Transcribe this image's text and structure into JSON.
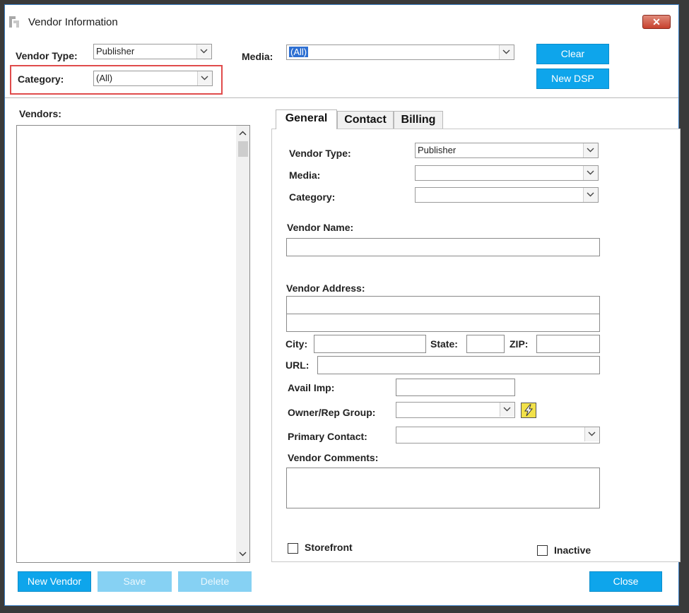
{
  "window": {
    "title": "Vendor Information",
    "close_glyph": "✕"
  },
  "filters": {
    "vendor_type_label": "Vendor Type:",
    "vendor_type_value": "Publisher",
    "category_label": "Category:",
    "category_value": "(All)",
    "media_label": "Media:",
    "media_value": "(All)"
  },
  "buttons": {
    "clear": "Clear",
    "new_dsp": "New DSP",
    "new_vendor": "New Vendor",
    "save": "Save",
    "delete": "Delete",
    "close": "Close"
  },
  "vendors": {
    "label": "Vendors:",
    "items": []
  },
  "tabs": [
    {
      "label": "General",
      "active": true
    },
    {
      "label": "Contact",
      "active": false
    },
    {
      "label": "Billing",
      "active": false
    }
  ],
  "general": {
    "vendor_type_label": "Vendor Type:",
    "vendor_type_value": "Publisher",
    "media_label": "Media:",
    "media_value": "",
    "category_label": "Category:",
    "category_value": "",
    "vendor_name_label": "Vendor Name:",
    "vendor_address_label": "Vendor Address:",
    "city_label": "City:",
    "state_label": "State:",
    "zip_label": "ZIP:",
    "url_label": "URL:",
    "avail_imp_label": "Avail Imp:",
    "owner_rep_group_label": "Owner/Rep Group:",
    "owner_rep_group_value": "",
    "primary_contact_label": "Primary Contact:",
    "primary_contact_value": "",
    "vendor_comments_label": "Vendor Comments:",
    "storefront_label": "Storefront",
    "inactive_label": "Inactive"
  },
  "colors": {
    "accent": "#0ea5eb",
    "highlight_box": "#e04b4b",
    "selection": "#2d6fd2"
  }
}
